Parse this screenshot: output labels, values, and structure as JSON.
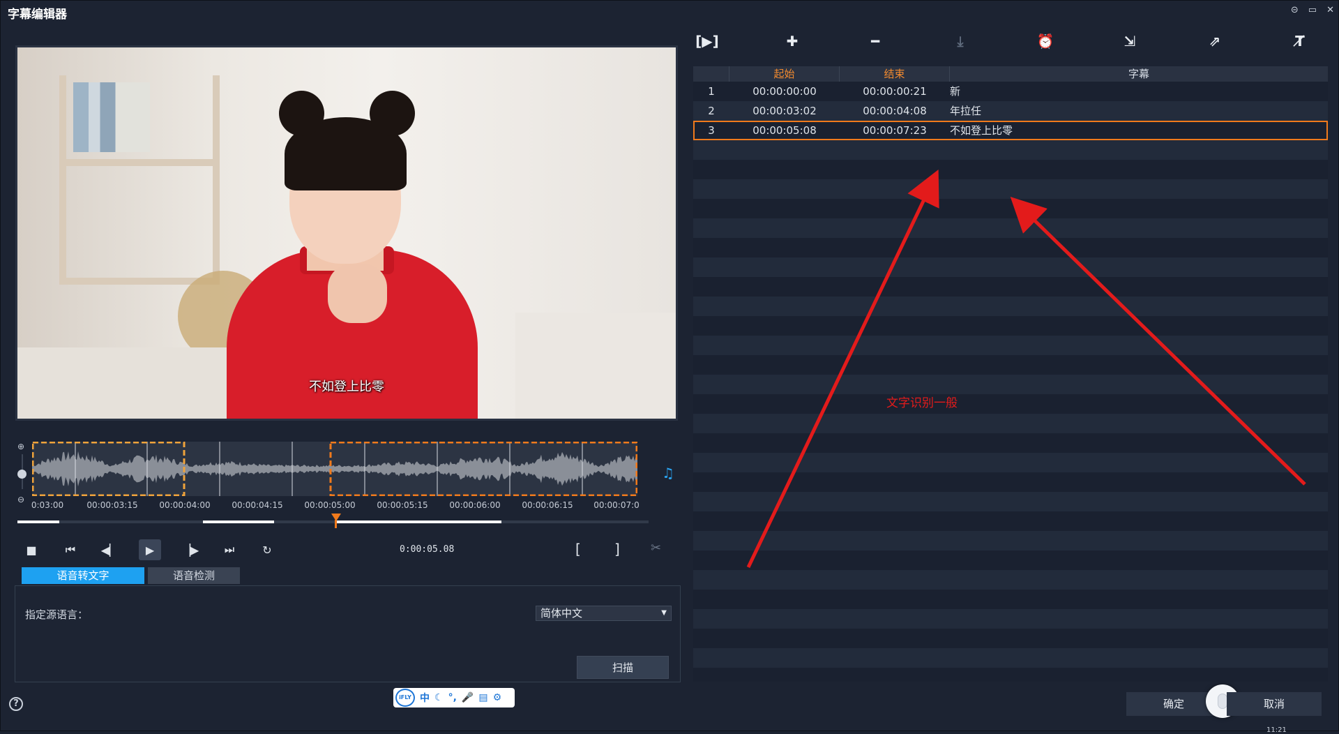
{
  "window": {
    "title": "字幕编辑器",
    "controls": [
      "⊝",
      "▭",
      "✕"
    ]
  },
  "video": {
    "subtitle_overlay": "不如登上比零"
  },
  "timeline": {
    "ticks": [
      "0:03:00",
      "00:00:03:15",
      "00:00:04:00",
      "00:00:04:15",
      "00:00:05:00",
      "00:00:05:15",
      "00:00:06:00",
      "00:00:06:15",
      "00:00:07:0"
    ],
    "timecode": "0:00:05.08"
  },
  "transport": {
    "icons": [
      "stop-icon",
      "go-to-start-icon",
      "previous-frame-icon",
      "play-icon",
      "next-frame-icon",
      "go-to-end-icon",
      "repeat-icon"
    ],
    "mark_in": "[",
    "mark_out": "]"
  },
  "tabs": {
    "speech_to_text": "语音转文字",
    "speech_detection": "语音检测"
  },
  "panel": {
    "source_language_label": "指定源语言：",
    "source_language_value": "简体中文",
    "scan_button": "扫描"
  },
  "toolbar": {
    "icons": [
      "play-subtitle-icon",
      "add-subtitle-icon",
      "remove-subtitle-icon",
      "merge-subtitle-icon",
      "alarm-icon",
      "import-icon",
      "export-icon",
      "text-style-icon"
    ]
  },
  "table": {
    "headers": {
      "start": "起始",
      "end": "结束",
      "subtitle": "字幕"
    },
    "rows": [
      {
        "index": "1",
        "start": "00:00:00:00",
        "end": "00:00:00:21",
        "text": "新"
      },
      {
        "index": "2",
        "start": "00:00:03:02",
        "end": "00:00:04:08",
        "text": "年拉任"
      },
      {
        "index": "3",
        "start": "00:00:05:08",
        "end": "00:00:07:23",
        "text": "不如登上比零"
      }
    ],
    "selected_row": 3
  },
  "annotation": {
    "text": "文字识别一般",
    "color": "#e31b1b"
  },
  "footer": {
    "help": "?",
    "ok_button": "确定",
    "cancel_button": "取消",
    "ime_logo": "iFLY",
    "ime_lang": "中",
    "clock": "11:21"
  },
  "colors": {
    "accent_blue": "#1ea1f1",
    "accent_orange": "#f07a1c",
    "background": "#1c2332"
  }
}
